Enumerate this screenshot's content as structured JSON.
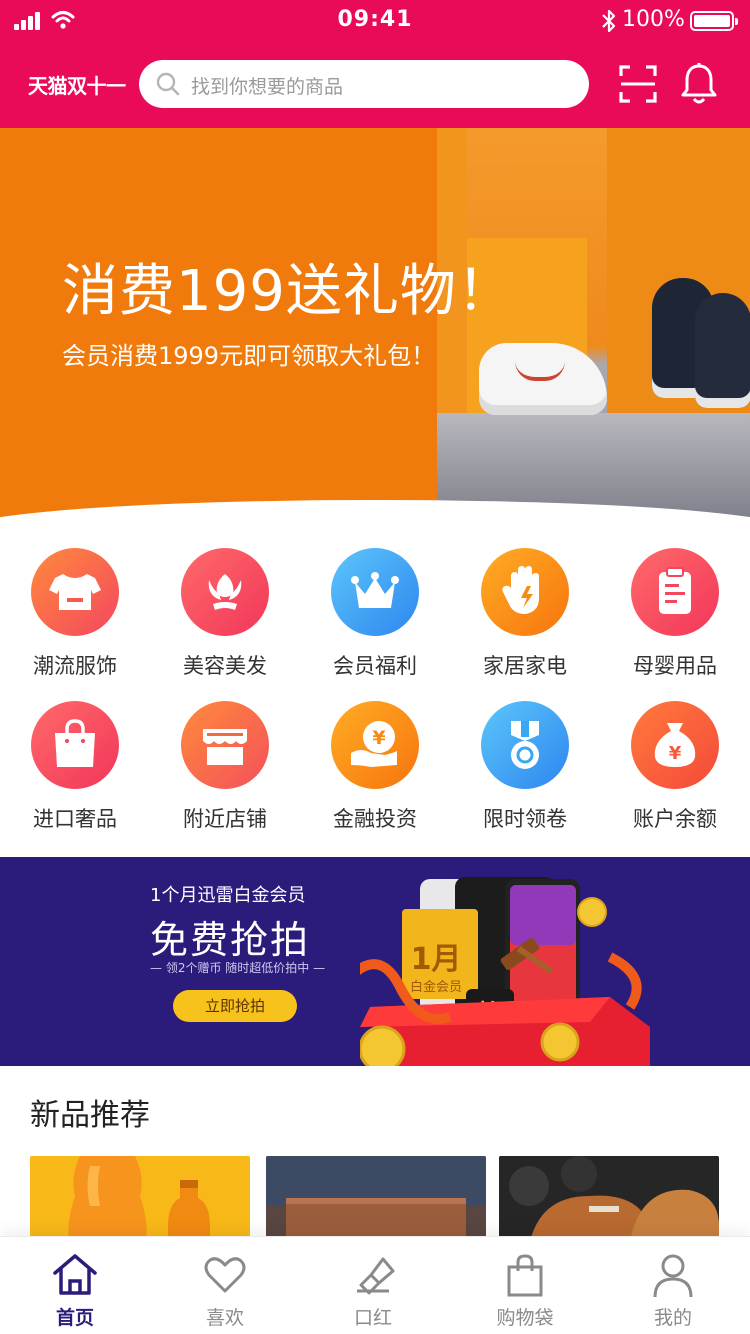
{
  "status_bar": {
    "time": "09:41",
    "battery": "100%"
  },
  "header": {
    "logo": "天猫双十一",
    "search_placeholder": "找到你想要的商品"
  },
  "banner": {
    "title": "消费199送礼物！",
    "subtitle": "会员消费1999元即可领取大礼包！"
  },
  "categories": [
    {
      "label": "潮流服饰",
      "icon": "tshirt-icon",
      "color": "#f75a4d"
    },
    {
      "label": "美容美发",
      "icon": "flower-icon",
      "color": "#f3485f"
    },
    {
      "label": "会员福利",
      "icon": "crown-icon",
      "color": "#3aa7f4"
    },
    {
      "label": "家居家电",
      "icon": "hand-icon",
      "color": "#f78a10"
    },
    {
      "label": "母婴用品",
      "icon": "clipboard-icon",
      "color": "#f4475f"
    },
    {
      "label": "进口奢品",
      "icon": "bag-icon",
      "color": "#f4475f"
    },
    {
      "label": "附近店铺",
      "icon": "store-icon",
      "color": "#f7683c"
    },
    {
      "label": "金融投资",
      "icon": "yen-coin-icon",
      "color": "#f78a10"
    },
    {
      "label": "限时领卷",
      "icon": "medal-icon",
      "color": "#3aa7f4"
    },
    {
      "label": "账户余额",
      "icon": "money-bag-icon",
      "color": "#f75a3d"
    }
  ],
  "promo": {
    "line1": "1个月迅雷白金会员",
    "title": "免费抢拍",
    "subtitle": "— 领2个赠币 随时超低价拍中 —",
    "button": "立即抢拍",
    "card_text": "1月",
    "card_sub": "白金会员",
    "auction_label": "拍"
  },
  "new_products": {
    "title": "新品推荐"
  },
  "tabs": [
    {
      "label": "首页",
      "icon": "home-icon",
      "active": true
    },
    {
      "label": "喜欢",
      "icon": "heart-icon",
      "active": false
    },
    {
      "label": "口红",
      "icon": "lipstick-icon",
      "active": false
    },
    {
      "label": "购物袋",
      "icon": "shopping-bag-icon",
      "active": false
    },
    {
      "label": "我的",
      "icon": "user-icon",
      "active": false
    }
  ],
  "colors": {
    "header": "#ea0a5a",
    "banner": "#f07b0c",
    "promo": "#2b1c7c",
    "active_tab": "#2b1c7c"
  }
}
